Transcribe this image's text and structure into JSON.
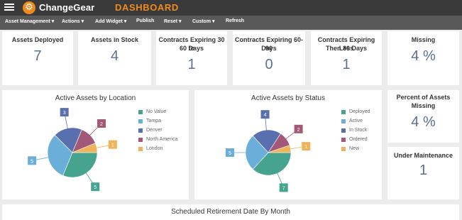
{
  "header": {
    "app_name": "ChangeGear",
    "page_title": "DASHBOARD",
    "brand_color": "#f08a1c"
  },
  "menu": [
    {
      "label": "Asset Management",
      "has_caret": true
    },
    {
      "label": "Actions",
      "has_caret": true
    },
    {
      "label": "Add Widget",
      "has_caret": true
    },
    {
      "label": "Publish",
      "has_caret": false
    },
    {
      "label": "Reset",
      "has_caret": true
    },
    {
      "label": "Custom",
      "has_caret": true
    },
    {
      "label": "Refresh",
      "has_caret": false
    }
  ],
  "kpis": {
    "deployed": {
      "title": "Assets Deployed",
      "value": "7"
    },
    "in_stock": {
      "title": "Assets in Stock",
      "value": "4"
    },
    "exp_30_60": {
      "title_1": "Contracts Expiring 30 to",
      "title_2": "60 Days",
      "value": "1"
    },
    "exp_60_90": {
      "title_1": "Contracts Expiring 60-90",
      "title_2": "Days",
      "value": "0"
    },
    "exp_lt_30": {
      "title_1": "Contracts Expiring Less",
      "title_2": "Then 30 Days",
      "value": "1"
    },
    "missing": {
      "title": "Missing",
      "value": "4 %"
    },
    "pct_missing": {
      "title_1": "Percent of Assets",
      "title_2": "Missing",
      "value": "4 %"
    },
    "maintenance": {
      "title": "Under Maintenance",
      "value": "1"
    }
  },
  "bottom_panel": {
    "title": "Scheduled Retirement Date By Month"
  },
  "chart_data": [
    {
      "type": "pie",
      "title": "Active Assets by Location",
      "categories": [
        "No Value",
        "Tampa",
        "Denver",
        "North America",
        "London"
      ],
      "values": [
        5,
        5,
        3,
        2,
        1
      ],
      "colors": [
        "#45a38e",
        "#6aaed9",
        "#5a6fad",
        "#a35878",
        "#efb45a"
      ],
      "legend_placement": "right"
    },
    {
      "type": "pie",
      "title": "Active Assets by Status",
      "categories": [
        "Deployed",
        "Active",
        "In Stock",
        "Ordered",
        "New"
      ],
      "values": [
        7,
        5,
        4,
        2,
        1
      ],
      "colors": [
        "#45a38e",
        "#6aaed9",
        "#5a6fad",
        "#a35878",
        "#efb45a"
      ],
      "legend_placement": "right"
    }
  ]
}
